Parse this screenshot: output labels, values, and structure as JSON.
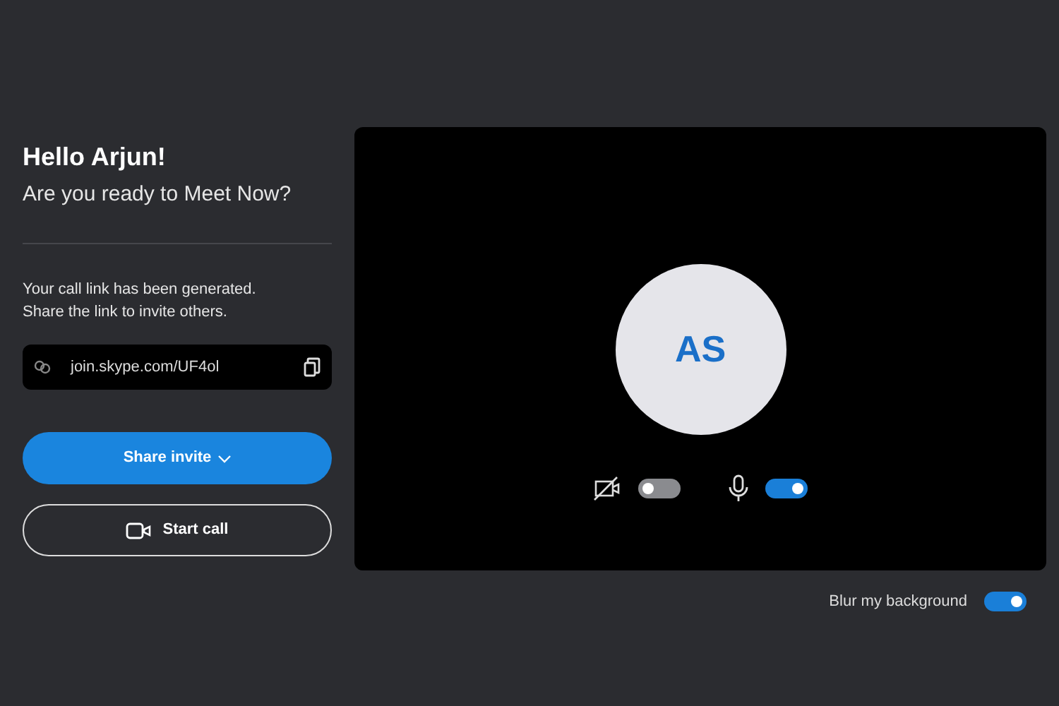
{
  "greeting": "Hello Arjun!",
  "subtitle": "Are you ready to Meet Now?",
  "info": "Your call link has been generated.\nShare the link to invite others.",
  "link": {
    "value": "join.skype.com/UF4ol"
  },
  "share_button": {
    "label": "Share invite"
  },
  "start_button": {
    "label": "Start call"
  },
  "preview": {
    "avatar": "AS"
  },
  "toggles": [
    {
      "kind": "camera",
      "on": false
    },
    {
      "kind": "microphone",
      "on": true
    }
  ],
  "blur": {
    "label": "Blur my background",
    "on": true
  }
}
